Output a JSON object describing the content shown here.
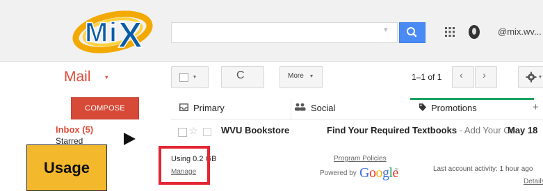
{
  "brand": {
    "logo_text": "MiX",
    "accent": "#dd4b39"
  },
  "search": {
    "value": "",
    "placeholder": "",
    "caret": "▾",
    "button_icon": "search-icon"
  },
  "header": {
    "account": "@mix.wv..."
  },
  "toolbar": {
    "mail_label": "Mail",
    "mail_caret": "▾",
    "select_caret": "▾",
    "refresh_glyph": "C",
    "more_label": "More",
    "more_caret": "▾",
    "pager": "1–1 of 1",
    "prev_glyph": "‹",
    "next_glyph": "›",
    "settings_caret": "▾"
  },
  "nav": {
    "compose": "COMPOSE",
    "inbox": "Inbox (5)",
    "starred": "Starred"
  },
  "tabs": [
    {
      "label": "Primary",
      "icon": "inbox-icon"
    },
    {
      "label": "Social",
      "icon": "people-icon"
    },
    {
      "label": "Promotions",
      "icon": "tag-icon",
      "active": true
    }
  ],
  "tab_add": "+",
  "emails": [
    {
      "sender": "WVU Bookstore",
      "subject": "Find Your Required Textbooks",
      "snippet": " - Add Your Co",
      "date": "May 18"
    }
  ],
  "footer": {
    "usage": "Using 0.2 GB",
    "manage": "Manage",
    "program_policies": "Program Policies",
    "powered_by": "Powered by",
    "google": "Google",
    "google_tm": "™",
    "last_activity": "Last account activity: 1 hour ago",
    "details": "Details"
  },
  "annotation": {
    "callout_label": "Usage",
    "callout_color": "#f4b82d",
    "highlight_color": "#e32633"
  }
}
